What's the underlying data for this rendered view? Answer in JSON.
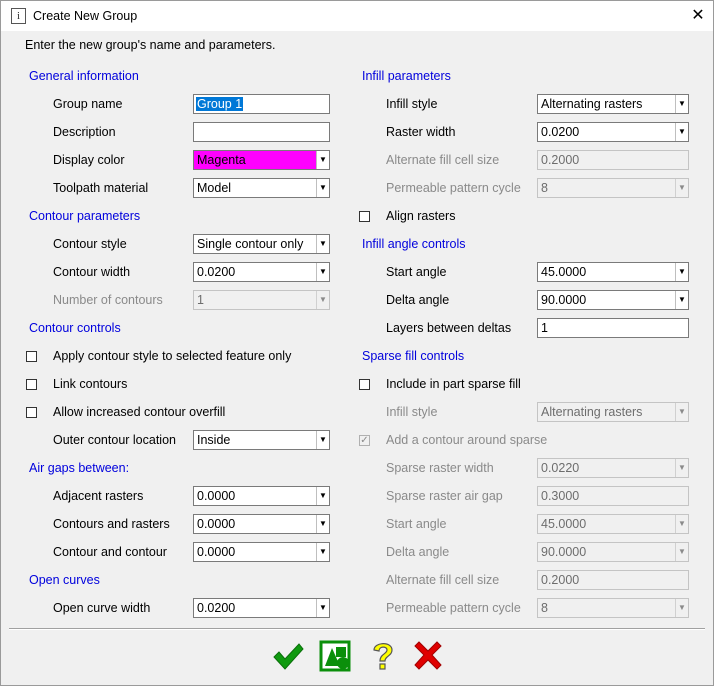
{
  "window": {
    "title": "Create New Group",
    "close_glyph": "✕",
    "icon_glyph": "i"
  },
  "instruction": "Enter the new group's name and parameters.",
  "general": {
    "header": "General information",
    "group_name_label": "Group name",
    "group_name_value": "Group 1",
    "description_label": "Description",
    "description_value": "",
    "display_color_label": "Display color",
    "display_color_value": "Magenta",
    "display_color_swatch": "#ff00ff",
    "toolpath_material_label": "Toolpath material",
    "toolpath_material_value": "Model"
  },
  "contour": {
    "header": "Contour parameters",
    "style_label": "Contour style",
    "style_value": "Single contour only",
    "width_label": "Contour width",
    "width_value": "0.0200",
    "number_label": "Number of contours",
    "number_value": "1"
  },
  "contour_controls": {
    "header": "Contour controls",
    "apply_style_label": "Apply contour style to selected feature only",
    "link_label": "Link contours",
    "overfill_label": "Allow increased contour overfill",
    "outer_location_label": "Outer contour location",
    "outer_location_value": "Inside"
  },
  "air_gaps": {
    "header": "Air gaps between:",
    "adjacent_label": "Adjacent rasters",
    "adjacent_value": "0.0000",
    "contours_rasters_label": "Contours and rasters",
    "contours_rasters_value": "0.0000",
    "contour_contour_label": "Contour and contour",
    "contour_contour_value": "0.0000"
  },
  "open_curves": {
    "header": "Open curves",
    "width_label": "Open curve width",
    "width_value": "0.0200"
  },
  "infill": {
    "header": "Infill parameters",
    "style_label": "Infill style",
    "style_value": "Alternating rasters",
    "raster_width_label": "Raster width",
    "raster_width_value": "0.0200",
    "alt_cell_label": "Alternate fill cell size",
    "alt_cell_value": "0.2000",
    "permeable_label": "Permeable pattern cycle",
    "permeable_value": "8",
    "align_label": "Align rasters"
  },
  "infill_angle": {
    "header": "Infill angle controls",
    "start_label": "Start angle",
    "start_value": "45.0000",
    "delta_label": "Delta angle",
    "delta_value": "90.0000",
    "layers_label": "Layers between deltas",
    "layers_value": "1"
  },
  "sparse": {
    "header": "Sparse fill controls",
    "include_label": "Include in part sparse fill",
    "style_label": "Infill style",
    "style_value": "Alternating rasters",
    "add_contour_label": "Add a contour around sparse",
    "add_contour_checked": "✓",
    "raster_width_label": "Sparse raster width",
    "raster_width_value": "0.0220",
    "air_gap_label": "Sparse raster air gap",
    "air_gap_value": "0.3000",
    "start_label": "Start angle",
    "start_value": "45.0000",
    "delta_label": "Delta angle",
    "delta_value": "90.0000",
    "alt_cell_label": "Alternate fill cell size",
    "alt_cell_value": "0.2000",
    "permeable_label": "Permeable pattern cycle",
    "permeable_value": "8"
  },
  "buttons": {
    "ok_icon": "checkmark-icon",
    "ok_color": "#0f9a0f",
    "preview_icon": "shapes-icon",
    "preview_color": "#0b8f0b",
    "help_icon": "question-icon",
    "help_color": "#ffff00",
    "cancel_icon": "x-icon",
    "cancel_color": "#e00000"
  },
  "colors": {
    "header_blue": "#0000dd",
    "selection": "#0078d7"
  }
}
